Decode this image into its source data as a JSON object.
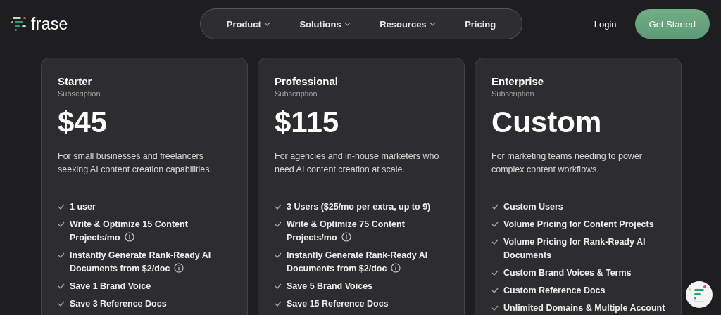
{
  "header": {
    "logo": {
      "text": "frase"
    },
    "nav": [
      {
        "label": "Product",
        "has_menu": true
      },
      {
        "label": "Solutions",
        "has_menu": true
      },
      {
        "label": "Resources",
        "has_menu": true
      },
      {
        "label": "Pricing",
        "has_menu": false
      }
    ],
    "login": "Login",
    "cta": "Get Started"
  },
  "plans": [
    {
      "name": "Starter",
      "type": "Subscription",
      "price": "$45",
      "description": "For small businesses and freelancers seeking AI content creation capabilities.",
      "features": [
        {
          "text": "1 user",
          "info": false
        },
        {
          "text": "Write & Optimize 15 Content Projects/mo",
          "info": true
        },
        {
          "text": "Instantly Generate Rank-Ready AI Documents from $2/doc",
          "info": true
        },
        {
          "text": "Save 1 Brand Voice",
          "info": false
        },
        {
          "text": "Save 3 Reference Docs",
          "info": false
        }
      ]
    },
    {
      "name": "Professional",
      "type": "Subscription",
      "price": "$115",
      "description": "For agencies and in-house marketers who need AI content creation at scale.",
      "features": [
        {
          "text": "3 Users ($25/mo per extra, up to 9)",
          "info": false
        },
        {
          "text": "Write & Optimize 75 Content Projects/mo",
          "info": true
        },
        {
          "text": "Instantly Generate Rank-Ready AI Documents from $2/doc",
          "info": true
        },
        {
          "text": "Save 5 Brand Voices",
          "info": false
        },
        {
          "text": "Save 15 Reference Docs",
          "info": false
        }
      ]
    },
    {
      "name": "Enterprise",
      "type": "Subscription",
      "price": "Custom",
      "description": "For marketing teams needing to power complex content workflows.",
      "features": [
        {
          "text": "Custom Users",
          "info": false
        },
        {
          "text": "Volume Pricing for Content Projects",
          "info": false
        },
        {
          "text": "Volume Pricing for Rank-Ready AI Documents",
          "info": false
        },
        {
          "text": "Custom Brand Voices & Terms",
          "info": false
        },
        {
          "text": "Custom Reference Docs",
          "info": false
        },
        {
          "text": "Unlimited Domains & Multiple Account",
          "info": false
        }
      ]
    }
  ]
}
